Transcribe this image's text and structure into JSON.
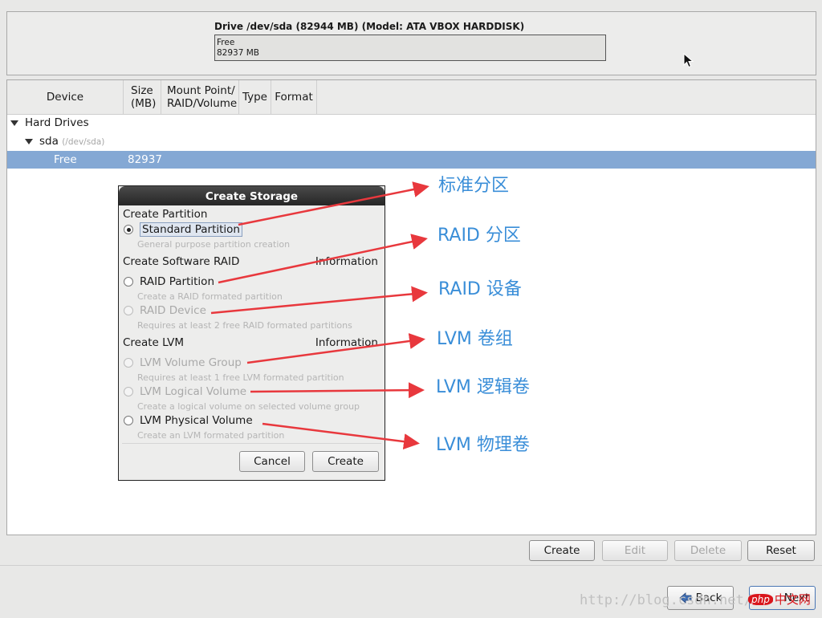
{
  "drive": {
    "title": "Drive /dev/sda (82944 MB) (Model: ATA VBOX HARDDISK)",
    "bar_line1": "Free",
    "bar_line2": "82937 MB"
  },
  "table": {
    "columns": {
      "device": "Device",
      "size_1": "Size",
      "size_2": "(MB)",
      "mount_1": "Mount Point/",
      "mount_2": "RAID/Volume",
      "type": "Type",
      "format": "Format"
    },
    "tree": {
      "hard_drives": "Hard Drives",
      "sda": "sda",
      "sda_path": "(/dev/sda)",
      "free_label": "Free",
      "free_size": "82937"
    }
  },
  "dialog": {
    "title": "Create Storage",
    "section_partition": "Create Partition",
    "standard_partition": "Standard Partition",
    "standard_desc": "General purpose partition creation",
    "section_raid": "Create Software RAID",
    "raid_info": "Information",
    "raid_partition": "RAID Partition",
    "raid_partition_desc": "Create a RAID formated partition",
    "raid_device": "RAID Device",
    "raid_device_desc": "Requires at least 2 free RAID formated partitions",
    "section_lvm": "Create LVM",
    "lvm_info": "Information",
    "lvm_volume_group": "LVM Volume Group",
    "lvm_volume_group_desc": "Requires at least 1 free LVM formated partition",
    "lvm_logical_volume": "LVM Logical Volume",
    "lvm_logical_volume_desc": "Create a logical volume on selected volume group",
    "lvm_physical_volume": "LVM Physical Volume",
    "lvm_physical_volume_desc": "Create an LVM formated partition",
    "cancel": "Cancel",
    "create": "Create"
  },
  "annotations": {
    "standard": "标准分区",
    "raid_partition": "RAID 分区",
    "raid_device": "RAID 设备",
    "lvm_volume_group": "LVM 卷组",
    "lvm_logical_volume": "LVM 逻辑卷",
    "lvm_physical_volume": "LVM 物理卷",
    "arrow_color": "#e8383d",
    "text_color": "#3a8ed8"
  },
  "actions": {
    "create": "Create",
    "edit": "Edit",
    "delete": "Delete",
    "reset": "Reset"
  },
  "nav": {
    "back": "Back",
    "next": "Next"
  },
  "watermark": {
    "url": "http://blog.csdn.net/",
    "php_badge": "php",
    "php_text": "中文网"
  }
}
